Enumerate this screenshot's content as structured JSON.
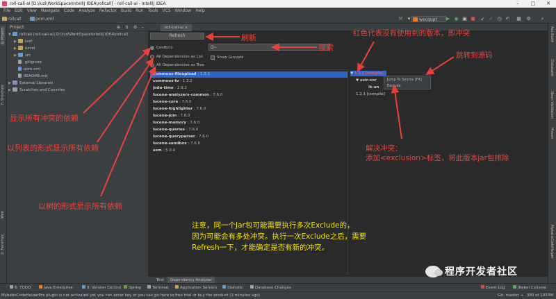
{
  "window": {
    "title": "roll-call-ai [D:\\luzi\\WorkSpace\\IntelliJ IDEA\\rollcall] - roll-call-ai - IntelliJ IDEA"
  },
  "menu": [
    "File",
    "Edit",
    "View",
    "Navigate",
    "Code",
    "Analyze",
    "Refactor",
    "Build",
    "Run",
    "Tools",
    "VCS",
    "Window",
    "Help"
  ],
  "navbar": {
    "crumb1": "rollcall",
    "crumb2": "pom.xml",
    "run_config": "wecqupt"
  },
  "project_panel": {
    "header": "Project",
    "tree": [
      {
        "label": "rollcall [roll-call-ai]  D:\\luzi\\WorkSpace\\IntelliJ IDEA\\rollcall",
        "icon": "module-folder",
        "expanded": true
      },
      {
        "label": "test",
        "icon": "folder"
      },
      {
        "label": "excel",
        "icon": "folder"
      },
      {
        "label": "src",
        "icon": "folder"
      },
      {
        "label": ".gitignore",
        "icon": "file"
      },
      {
        "label": "pom.xml",
        "icon": "file"
      },
      {
        "label": "README.md",
        "icon": "file"
      },
      {
        "label": "External Libraries",
        "icon": "library"
      },
      {
        "label": "Scratches and Consoles",
        "icon": "scratch"
      }
    ]
  },
  "left_strip": [
    "1: Project",
    "7: Structure",
    "Web",
    "2: Favorites"
  ],
  "right_strip": [
    "Ant Build",
    "Database",
    "Bean Validation",
    "Maven",
    "MybatisCodeHelper"
  ],
  "editor_tab": "roll-call-ai",
  "maven_helper": {
    "refresh_label": "Refresh",
    "options": [
      "Conflicts",
      "All Dependencies as List",
      "All Dependencies as Tree"
    ],
    "search_placeholder": "Q~",
    "show_groupid": "Show GroupId",
    "dependencies": [
      {
        "name": "commons-fileupload",
        "version": " : 1.2.1",
        "selected": true
      },
      {
        "name": "commons-io",
        "version": " : 1.3.2"
      },
      {
        "name": "joda-time",
        "version": " : 2.9.2"
      },
      {
        "name": "lucene-analyzers-common",
        "version": " : 7.6.0"
      },
      {
        "name": "lucene-core",
        "version": " : 7.6.0"
      },
      {
        "name": "lucene-highlighter",
        "version": " : 7.6.0"
      },
      {
        "name": "lucene-join",
        "version": " : 7.6.0"
      },
      {
        "name": "lucene-memory",
        "version": " : 7.6.0"
      },
      {
        "name": "lucene-queries",
        "version": " : 7.6.0"
      },
      {
        "name": "lucene-queryparser",
        "version": " : 7.6.0"
      },
      {
        "name": "lucene-sandbox",
        "version": " : 7.6.0"
      },
      {
        "name": "asm",
        "version": " : 5.0.4"
      }
    ],
    "tree": {
      "node1": "1.3.3 [compile]",
      "node2": "solr-cor",
      "node3": "ik-an",
      "node4": "1.2.1 [compile]"
    },
    "context_menu": [
      "Jump To Source [F4]",
      "Exclude"
    ]
  },
  "bottom_tabs": [
    "Text",
    "Dependency Analyzer"
  ],
  "toolwindows": [
    "6: TODO",
    "Java Enterprise",
    "9: Version Control",
    "Spring",
    "Terminal",
    "Application Servers",
    "Statistic",
    "Database Changes",
    "Event Log",
    "JRebel Console"
  ],
  "status": {
    "message": "MybatisCodeHelperPro plugin is not activated yet you can enter key or you can go here to free trial or buy the product (3 minutes ago)",
    "git": "Git: master ÷",
    "memory": "380 of 1933M"
  },
  "annotations": {
    "refresh": "刷新",
    "search": "搜索",
    "red_meaning": "红色代表没有使用到的版本，即冲突",
    "jump_source": "跳转到源码",
    "show_conflicts": "显示所有冲突的依赖",
    "show_list": "以列表的形式显示所有依赖",
    "show_tree": "以树的形式显示所有依赖",
    "resolve_title": "解决冲突：",
    "resolve_body": "添加<exclusion>标签，将此版本jar包排除",
    "note_line1": "注意，同一个Jar包可能需要执行多次Exclude的，",
    "note_line2": "因为可能会有多处冲突。执行一次Exclude之后，需要",
    "note_line3": "Refresh一下，才能确定是否有新的冲突。"
  },
  "watermark": "程序开发者社区",
  "colors": {
    "annotation_red": "#e8413a",
    "note_yellow": "#f2e100",
    "selection_blue": "#2f65ca",
    "ide_dark": "#2b2b2b",
    "ide_panel": "#3c3f41"
  }
}
